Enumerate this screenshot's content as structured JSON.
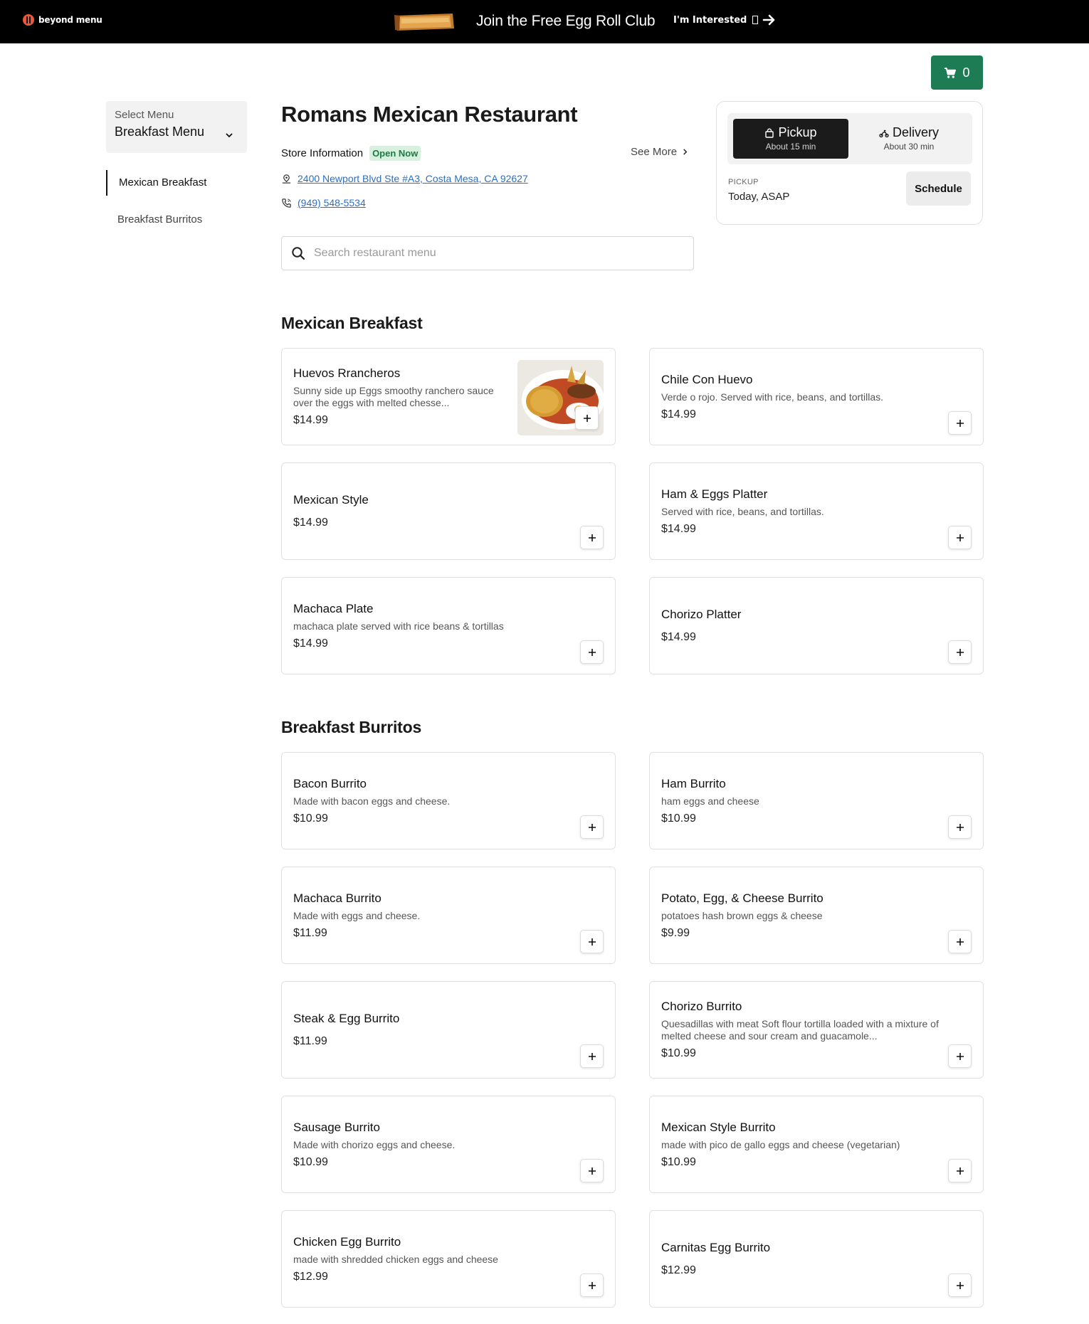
{
  "topbar": {
    "logo_text": "beyond menu",
    "promo_text": "Join the Free Egg Roll Club",
    "interest_label": "I'm Interested"
  },
  "cart": {
    "count": "0"
  },
  "sidebar": {
    "select_label": "Select Menu",
    "selected_menu": "Breakfast Menu",
    "items": [
      {
        "label": "Mexican Breakfast"
      },
      {
        "label": "Breakfast Burritos"
      }
    ]
  },
  "header": {
    "title": "Romans Mexican Restaurant",
    "store_info_label": "Store Information",
    "status_badge": "Open Now",
    "see_more": "See More",
    "address": "2400 Newport Blvd Ste #A3, Costa Mesa, CA 92627",
    "phone": "(949) 548-5534"
  },
  "search": {
    "placeholder": "Search restaurant menu"
  },
  "order": {
    "pickup_label": "Pickup",
    "pickup_sub": "About 15 min",
    "delivery_label": "Delivery",
    "delivery_sub": "About 30 min",
    "mode_caption": "PICKUP",
    "time": "Today, ASAP",
    "schedule_label": "Schedule"
  },
  "sections": [
    {
      "title": "Mexican Breakfast",
      "items": [
        {
          "name": "Huevos Rrancheros",
          "desc": "Sunny side up Eggs smoothy ranchero sauce over the eggs with melted chesse...",
          "price": "$14.99"
        },
        {
          "name": "Chile Con Huevo",
          "desc": "Verde o rojo. Served with rice, beans, and tortillas.",
          "price": "$14.99"
        },
        {
          "name": "Mexican Style",
          "desc": "",
          "price": "$14.99"
        },
        {
          "name": "Ham & Eggs Platter",
          "desc": "Served with rice, beans, and tortillas.",
          "price": "$14.99"
        },
        {
          "name": "Machaca Plate",
          "desc": "machaca plate served with rice beans & tortillas",
          "price": "$14.99"
        },
        {
          "name": "Chorizo Platter",
          "desc": "",
          "price": "$14.99"
        }
      ]
    },
    {
      "title": "Breakfast Burritos",
      "items": [
        {
          "name": "Bacon Burrito",
          "desc": "Made with bacon eggs and cheese.",
          "price": "$10.99"
        },
        {
          "name": "Ham Burrito",
          "desc": "ham eggs and cheese",
          "price": "$10.99"
        },
        {
          "name": "Machaca Burrito",
          "desc": "Made with eggs and cheese.",
          "price": "$11.99"
        },
        {
          "name": "Potato, Egg, & Cheese Burrito",
          "desc": "potatoes hash brown eggs & cheese",
          "price": "$9.99"
        },
        {
          "name": "Steak & Egg Burrito",
          "desc": "",
          "price": "$11.99"
        },
        {
          "name": "Chorizo Burrito",
          "desc": "Quesadillas with meat Soft flour tortilla loaded with a mixture of melted cheese and sour cream and guacamole...",
          "price": "$10.99"
        },
        {
          "name": "Sausage Burrito",
          "desc": "Made with chorizo eggs and cheese.",
          "price": "$10.99"
        },
        {
          "name": "Mexican Style Burrito",
          "desc": "made with pico de gallo eggs and cheese (vegetarian)",
          "price": "$10.99"
        },
        {
          "name": "Chicken Egg Burrito",
          "desc": "made with shredded chicken eggs and cheese",
          "price": "$12.99"
        },
        {
          "name": "Carnitas Egg Burrito",
          "desc": "",
          "price": "$12.99"
        }
      ]
    }
  ]
}
